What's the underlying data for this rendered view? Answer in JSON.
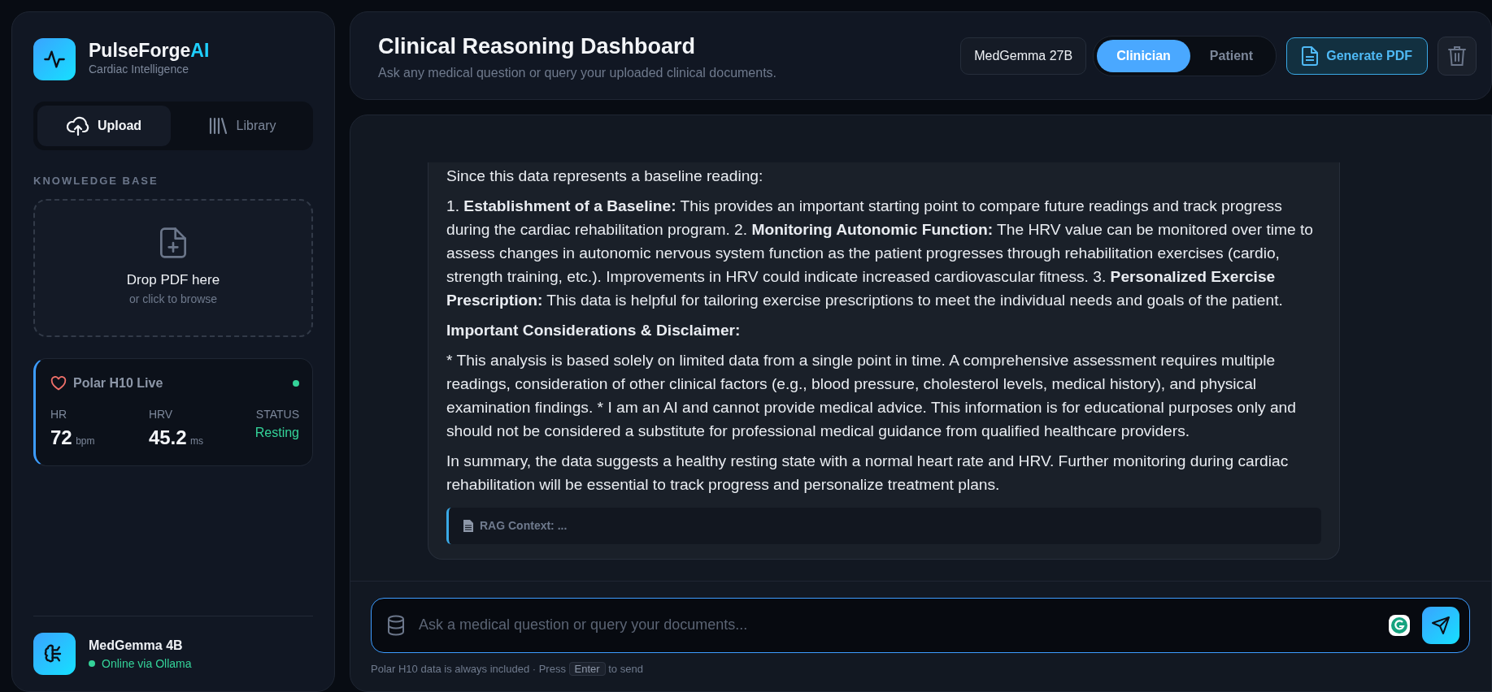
{
  "sidebar": {
    "brand": {
      "name": "PulseForge",
      "accent": "AI",
      "subtitle": "Cardiac Intelligence"
    },
    "tabs": [
      {
        "label": "Upload",
        "kind": "upload",
        "selected": true
      },
      {
        "label": "Library",
        "kind": "library",
        "selected": false
      }
    ],
    "section_label": "KNOWLEDGE BASE",
    "dropzone": {
      "title": "Drop PDF here",
      "hint": "or click to browse"
    },
    "device": {
      "title": "Polar H10 Live",
      "connected": true,
      "metrics": [
        {
          "label": "HR",
          "value": "72",
          "unit": "bpm"
        },
        {
          "label": "HRV",
          "value": "45.2",
          "unit": "ms"
        },
        {
          "label": "STATUS",
          "value": "Resting"
        }
      ]
    },
    "model": {
      "name": "MedGemma 4B",
      "status": "Online via Ollama",
      "online": true
    }
  },
  "header": {
    "title": "Clinical Reasoning Dashboard",
    "subtitle": "Ask any medical question or query your uploaded clinical documents.",
    "model_badge": "MedGemma 27B",
    "modes": [
      {
        "label": "Clinician",
        "selected": true
      },
      {
        "label": "Patient",
        "selected": false
      }
    ],
    "pdf_button": "Generate PDF"
  },
  "message": {
    "paragraphs": [
      "Since this data represents a baseline reading:",
      "1. **Establishment of a Baseline:** This provides an important starting point to compare future readings and track progress during the cardiac rehabilitation program. 2. **Monitoring Autonomic Function:** The HRV value can be monitored over time to assess changes in autonomic nervous system function as the patient progresses through rehabilitation exercises (cardio, strength training, etc.). Improvements in HRV could indicate increased cardiovascular fitness. 3. **Personalized Exercise Prescription:** This data is helpful for tailoring exercise prescriptions to meet the individual needs and goals of the patient.",
      "**Important Considerations & Disclaimer:**",
      "* This analysis is based solely on limited data from a single point in time. A comprehensive assessment requires multiple readings, consideration of other clinical factors (e.g., blood pressure, cholesterol levels, medical history), and physical examination findings. * I am an AI and cannot provide medical advice. This information is for educational purposes only and should not be considered a substitute for professional medical guidance from qualified healthcare providers.",
      "In summary, the data suggests a healthy resting state with a normal heart rate and HRV. Further monitoring during cardiac rehabilitation will be essential to track progress and personalize treatment plans."
    ],
    "rag": {
      "label": "RAG Context:",
      "value": "..."
    }
  },
  "composer": {
    "placeholder": "Ask a medical question or query your documents...",
    "hint_before": "Polar H10 data is always included · Press",
    "key": "Enter",
    "hint_after": "to send"
  }
}
